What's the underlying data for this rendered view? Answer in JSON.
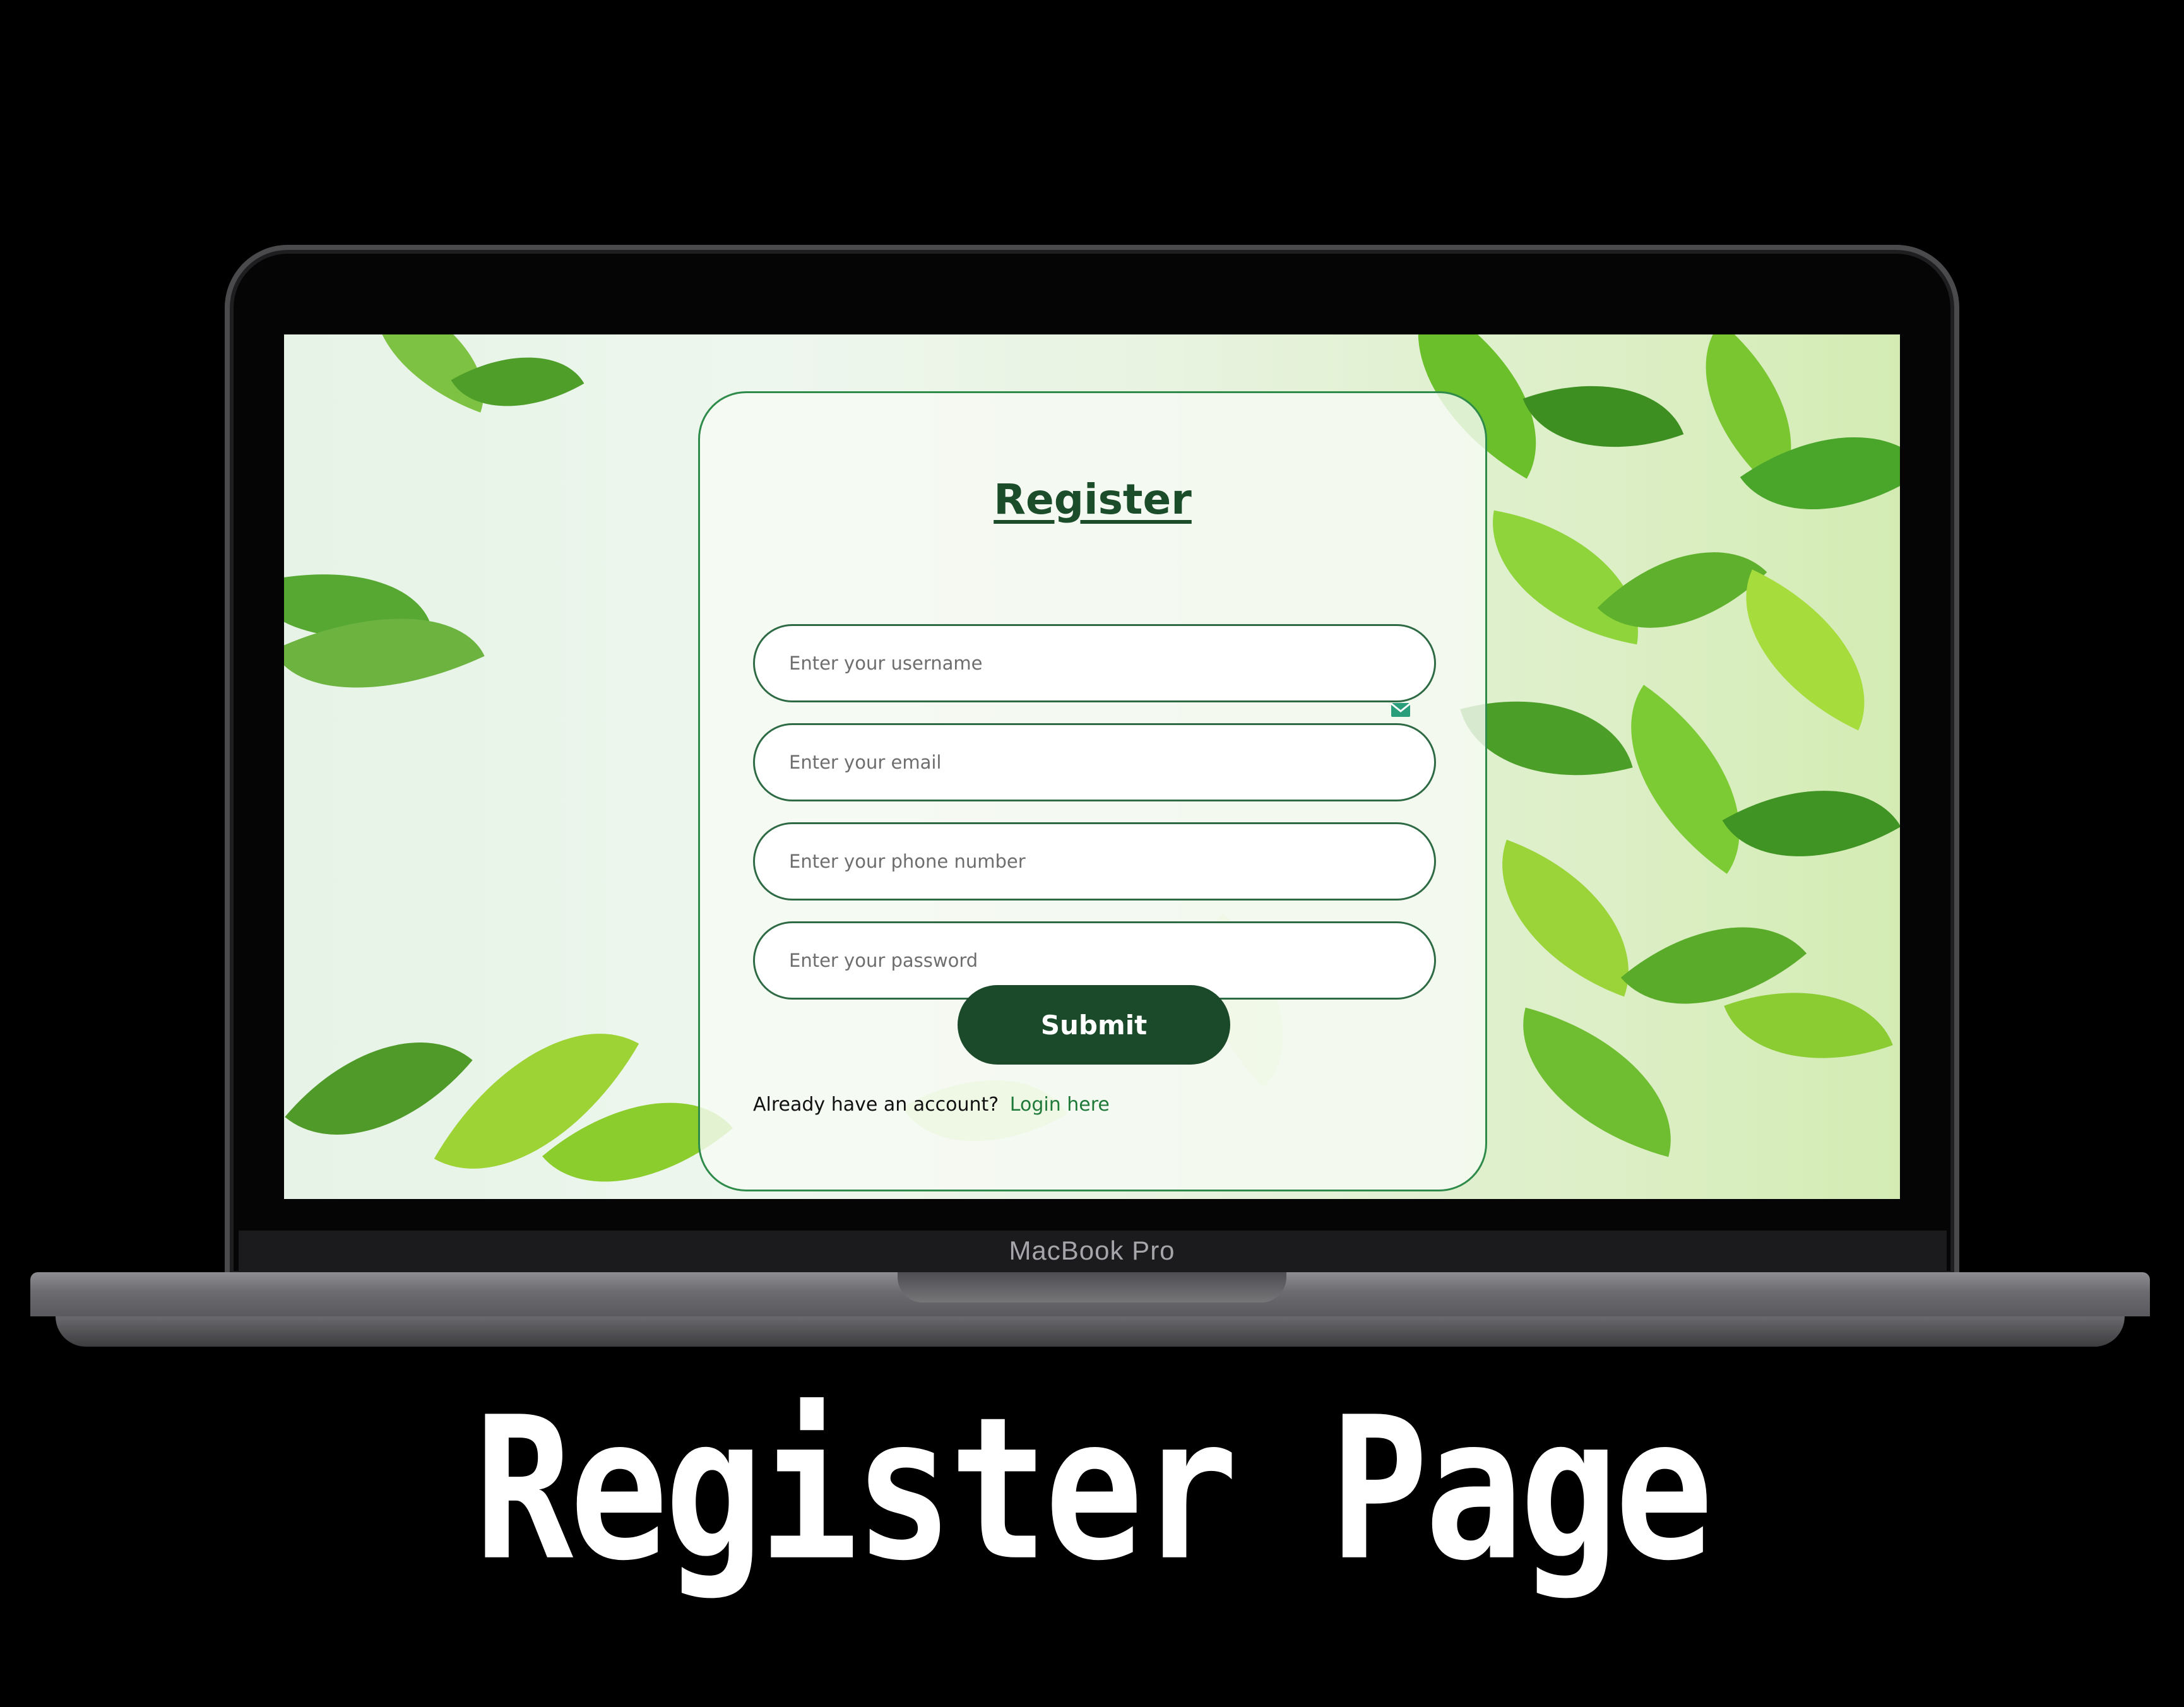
{
  "device": {
    "brand_label": "MacBook Pro"
  },
  "caption": "Register Page",
  "form": {
    "title": "Register",
    "username_placeholder": "Enter your username",
    "email_placeholder": "Enter your email",
    "phone_placeholder": "Enter your phone number",
    "password_placeholder": "Enter your password",
    "submit_label": "Submit",
    "account_prompt": "Already have an account?",
    "login_link": "Login here",
    "email_icon": "mail-icon"
  },
  "colors": {
    "primary": "#1b4a2a",
    "title": "#1c4d2b",
    "border": "#2e8b4a",
    "link": "#1f7a3a"
  }
}
